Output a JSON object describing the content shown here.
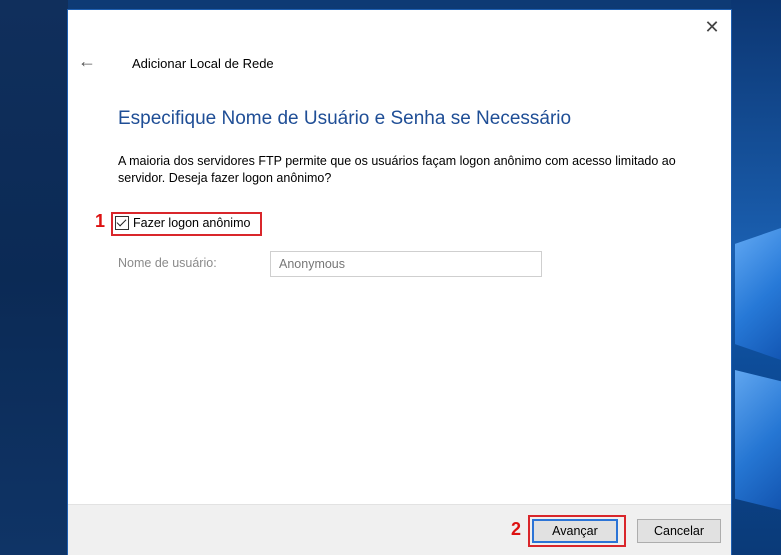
{
  "dialog": {
    "title": "Adicionar Local de Rede",
    "heading": "Especifique Nome de Usuário e Senha se Necessário",
    "description": "A maioria dos servidores FTP permite que os usuários façam logon anônimo com acesso limitado ao servidor. Deseja fazer logon anônimo?",
    "anonymous_checkbox": {
      "label": "Fazer logon anônimo",
      "checked": true
    },
    "username": {
      "label": "Nome de usuário:",
      "value": "Anonymous"
    },
    "buttons": {
      "next": "Avançar",
      "cancel": "Cancelar"
    },
    "icons": {
      "close": "close-icon",
      "back": "back-arrow-icon"
    }
  },
  "annotations": {
    "marker_1": "1",
    "marker_2": "2"
  },
  "colors": {
    "heading": "#1f4e96",
    "highlight": "#d9262b",
    "primary_border": "#2c74d6"
  }
}
